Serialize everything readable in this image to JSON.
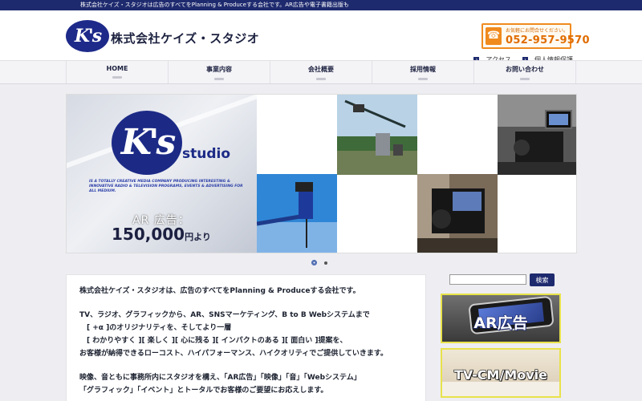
{
  "topbar": {
    "text": "株式会社ケイズ・スタジオは広告のすべてをPlanning & Produceする会社です。AR広告や電子書籍出版も"
  },
  "header": {
    "logo_text": "K's",
    "company_name": "株式会社ケイズ・スタジオ",
    "tel_lead": "お気軽にお問合せください。",
    "tel_number": "052-957-9570",
    "links": [
      "アクセス",
      "個人情報保護"
    ]
  },
  "nav": {
    "items": [
      "HOME",
      "事業内容",
      "会社概要",
      "採用情報",
      "お問い合わせ"
    ]
  },
  "slider": {
    "hero": {
      "logo_text": "K's",
      "studio_text": "studio",
      "tagline": "IS A TOTALLY CREATIVE MEDIA COMPANY PRODUCING INTERESTING & INNOVATIVE RADIO & TELEVISION PROGRAMS, EVENTS & ADVERTISING FOR ALL MEDIUM.",
      "ar_label": "AR 広告：",
      "price": "150,000",
      "price_suffix": "円より"
    },
    "pagination": [
      "slide-1",
      "slide-2"
    ]
  },
  "content": {
    "lines": [
      "株式会社ケイズ・スタジオは、広告のすべてをPlanning & Produceする会社です。",
      "",
      "TV、ラジオ、グラフィックから、AR、SNSマーケティング、B to B Webシステムまで",
      "　[ +α ]のオリジナリティを、そしてより一層",
      "　[ わかりやすく ][ 楽しく ][ 心に残る ][ インパクトのある ][ 面白い ]提案を、",
      "お客様が納得できるローコスト、ハイパフォーマンス、ハイクオリティでご提供していきます。",
      "",
      "映像、音ともに事務所内にスタジオを構え、「AR広告」「映像」「音」「Webシステム」",
      "「グラフィック」「イベント」とトータルでお客様のご要望にお応えします。"
    ]
  },
  "sidebar": {
    "search_placeholder": "",
    "search_button": "検索",
    "banners": [
      "AR広告",
      "TV-CM/Movie"
    ]
  }
}
